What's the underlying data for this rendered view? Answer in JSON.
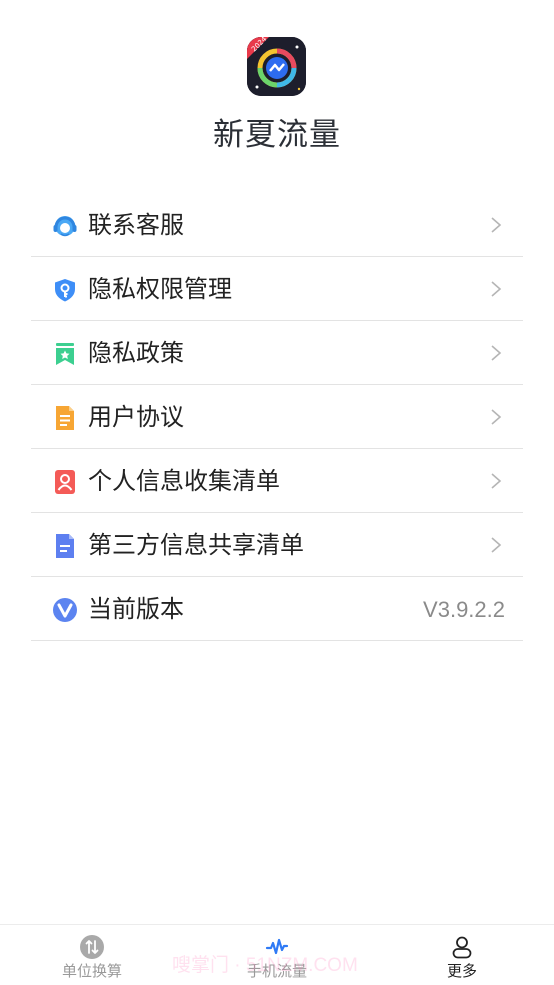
{
  "app": {
    "title": "新夏流量",
    "icon_badge": "2024"
  },
  "menu": {
    "items": [
      {
        "label": "联系客服",
        "icon": "headset-icon",
        "icon_color": "#3d9bf0"
      },
      {
        "label": "隐私权限管理",
        "icon": "shield-key-icon",
        "icon_color": "#3e8ef7"
      },
      {
        "label": "隐私政策",
        "icon": "bookmark-star-icon",
        "icon_color": "#3ccf90"
      },
      {
        "label": "用户协议",
        "icon": "document-icon",
        "icon_color": "#f7a634"
      },
      {
        "label": "个人信息收集清单",
        "icon": "person-card-icon",
        "icon_color": "#f45b57"
      },
      {
        "label": "第三方信息共享清单",
        "icon": "file-list-icon",
        "icon_color": "#5d7ff0"
      },
      {
        "label": "当前版本",
        "icon": "v-logo-icon",
        "icon_color": "#5c84f0",
        "value": "V3.9.2.2"
      }
    ]
  },
  "tabbar": {
    "tabs": [
      {
        "label": "单位换算",
        "icon": "swap-circle-icon",
        "active": false
      },
      {
        "label": "手机流量",
        "icon": "pulse-icon",
        "active": false
      },
      {
        "label": "更多",
        "icon": "user-icon",
        "active": true
      }
    ]
  },
  "watermark": "嗖掌门 · 51NZM.COM",
  "colors": {
    "accent": "#2f7af5",
    "divider": "#e3e3e3",
    "text": "#222222",
    "muted": "#8a8a8a"
  }
}
